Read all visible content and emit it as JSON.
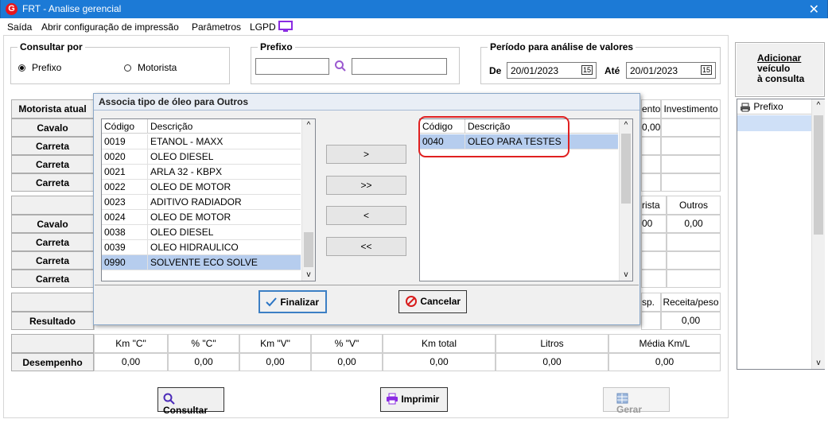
{
  "window": {
    "title": "FRT - Analise gerencial",
    "logo_letter": "G",
    "close": "✕"
  },
  "menu": [
    "Saída",
    "Abrir configuração de impressão",
    "Parâmetros",
    "LGPD"
  ],
  "consultar_por": {
    "label": "Consultar por",
    "options": [
      "Prefixo",
      "Motorista"
    ],
    "selected": "Prefixo"
  },
  "prefixo": {
    "label": "Prefixo",
    "value": "",
    "value2": ""
  },
  "periodo": {
    "label": "Período para análise de valores",
    "de_label": "De",
    "de": "20/01/2023",
    "ate_label": "Até",
    "ate": "20/01/2023",
    "cal": "15"
  },
  "add_vehicle": {
    "label1": "Adicionar",
    "label2": "veículo",
    "label3": "à consulta"
  },
  "side_list": {
    "header": "Prefixo"
  },
  "left_rows": {
    "motorista_atual": "Motorista atual",
    "block1": [
      "Cavalo",
      "Carreta",
      "Carreta",
      "Carreta"
    ],
    "block2": [
      "Cavalo",
      "Carreta",
      "Carreta",
      "Carreta"
    ],
    "resultado": "Resultado"
  },
  "right_partial": {
    "hdr1a": "ento",
    "hdr1b": "Investimento",
    "val1a": "0,00",
    "hdr2a": "rista",
    "hdr2b": "Outros",
    "val2a": "00",
    "val2b": "0,00",
    "hdr3a": "sp.",
    "hdr3b": "Receita/peso",
    "val3b": "0,00"
  },
  "desempenho": {
    "label": "Desempenho",
    "headers": [
      "Km \"C\"",
      "% \"C\"",
      "Km \"V\"",
      "% \"V\"",
      "Km total",
      "Litros",
      "Média Km/L"
    ],
    "values": [
      "0,00",
      "0,00",
      "0,00",
      "0,00",
      "0,00",
      "0,00",
      "0,00"
    ]
  },
  "bottom_buttons": {
    "consultar": "Consultar",
    "imprimir": "Imprimir",
    "gerar": "Gerar"
  },
  "dialog": {
    "title": "Associa tipo de óleo para Outros",
    "left_headers": [
      "Código",
      "Descrição"
    ],
    "left_rows": [
      {
        "code": "0019",
        "desc": "ETANOL - MAXX"
      },
      {
        "code": "0020",
        "desc": "OLEO DIESEL"
      },
      {
        "code": "0021",
        "desc": "ARLA 32 - KBPX"
      },
      {
        "code": "0022",
        "desc": "OLEO DE MOTOR"
      },
      {
        "code": "0023",
        "desc": "ADITIVO RADIADOR"
      },
      {
        "code": "0024",
        "desc": "OLEO DE MOTOR"
      },
      {
        "code": "0038",
        "desc": "OLEO DIESEL"
      },
      {
        "code": "0039",
        "desc": "OLEO HIDRAULICO"
      },
      {
        "code": "0990",
        "desc": "SOLVENTE ECO SOLVE"
      }
    ],
    "right_headers": [
      "Código",
      "Descrição"
    ],
    "right_rows": [
      {
        "code": "0040",
        "desc": "OLEO PARA TESTES"
      }
    ],
    "move_buttons": [
      ">",
      ">>",
      "<",
      "<<"
    ],
    "finalizar": "Finalizar",
    "cancelar": "Cancelar"
  }
}
